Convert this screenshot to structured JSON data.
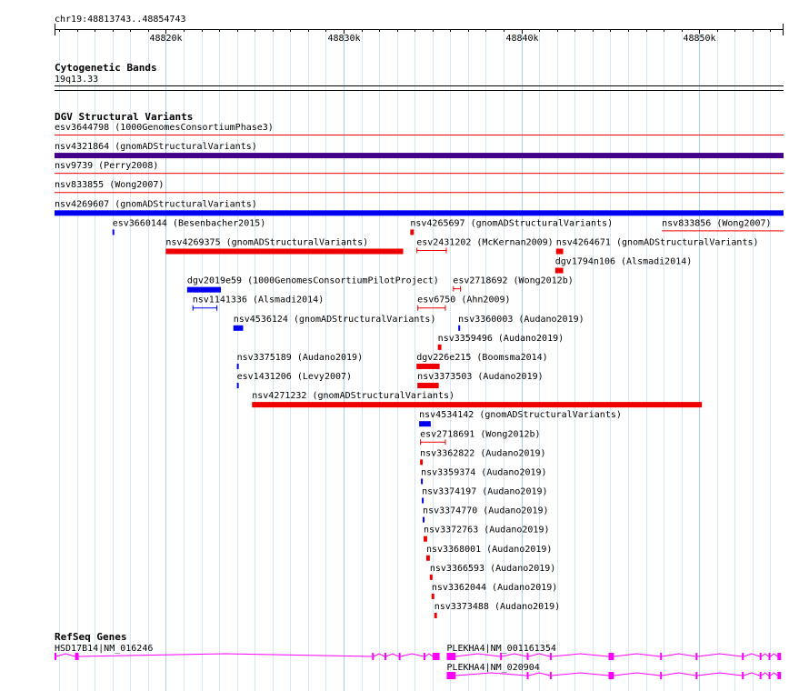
{
  "ruler": {
    "segment_label": "chr19:48813743..48854743",
    "start": 48813743,
    "end": 48854743,
    "ticks": [
      {
        "pos": 48820000,
        "label": "48820k"
      },
      {
        "pos": 48830000,
        "label": "48830k"
      },
      {
        "pos": 48840000,
        "label": "48840k"
      },
      {
        "pos": 48850000,
        "label": "48850k"
      }
    ]
  },
  "tracks": {
    "cytoband": {
      "title": "Cytogenetic Bands",
      "band_label": "19q13.33"
    },
    "dgv": {
      "title": "DGV Structural Variants",
      "colors": {
        "loss": "#ee0000",
        "gain": "#0000ee",
        "complex": "#440088"
      },
      "features": [
        {
          "name": "esv3644798 (1000GenomesConsortiumPhase3)",
          "start": 48813743,
          "end": 48854743,
          "type": "loss",
          "style": "line"
        },
        {
          "name": "nsv4321864 (gnomADStructuralVariants)",
          "start": 48813743,
          "end": 48854743,
          "type": "complex",
          "style": "bar"
        },
        {
          "name": "nsv9739 (Perry2008)",
          "start": 48813743,
          "end": 48854743,
          "type": "loss",
          "style": "line"
        },
        {
          "name": "nsv833855 (Wong2007)",
          "start": 48813743,
          "end": 48854743,
          "type": "loss",
          "style": "line"
        },
        {
          "name": "nsv4269607 (gnomADStructuralVariants)",
          "start": 48813743,
          "end": 48854743,
          "type": "gain",
          "style": "bar"
        },
        {
          "name": "esv3660144 (Besenbacher2015)",
          "start": 48817000,
          "end": 48817100,
          "type": "gain",
          "style": "bar"
        },
        {
          "name": "nsv4265697 (gnomADStructuralVariants)",
          "start": 48833750,
          "end": 48833950,
          "type": "loss",
          "style": "bar"
        },
        {
          "name": "nsv833856 (Wong2007)",
          "start": 48847900,
          "end": 48854743,
          "type": "loss",
          "style": "line"
        },
        {
          "name": "nsv4269375 (gnomADStructuralVariants)",
          "start": 48820000,
          "end": 48833350,
          "type": "loss",
          "style": "bar"
        },
        {
          "name": "esv2431202 (McKernan2009)",
          "start": 48834100,
          "end": 48835800,
          "type": "loss",
          "style": "interval"
        },
        {
          "name": "dgv1794n106 (Alsmadi2014)",
          "start": 48841900,
          "end": 48842350,
          "type": "loss",
          "style": "bar"
        },
        {
          "name": "dgv2019e59 (1000GenomesConsortiumPilotProject)",
          "start": 48821200,
          "end": 48823100,
          "type": "gain",
          "style": "bar"
        },
        {
          "name": "esv2718692 (Wong2012b)",
          "start": 48836150,
          "end": 48836600,
          "type": "loss",
          "style": "interval"
        },
        {
          "name": "nsv1141336 (Alsmadi2014)",
          "start": 48821500,
          "end": 48822900,
          "type": "gain",
          "style": "interval"
        },
        {
          "name": "esv6750 (Ahn2009)",
          "start": 48834150,
          "end": 48835750,
          "type": "loss",
          "style": "interval"
        },
        {
          "name": "nsv4264671 (gnomADStructuralVariants)",
          "start": 48841950,
          "end": 48842350,
          "type": "loss",
          "style": "bar"
        },
        {
          "name": "nsv4536124 (gnomADStructuralVariants)",
          "start": 48823800,
          "end": 48824350,
          "type": "gain",
          "style": "bar"
        },
        {
          "name": "nsv3359496 (Audano2019)",
          "start": 48835300,
          "end": 48835500,
          "type": "loss",
          "style": "bar"
        },
        {
          "name": "nsv3375189 (Audano2019)",
          "start": 48824000,
          "end": 48824100,
          "type": "gain",
          "style": "bar"
        },
        {
          "name": "dgv226e215 (Boomsma2014)",
          "start": 48834100,
          "end": 48835400,
          "type": "loss",
          "style": "bar"
        },
        {
          "name": "esv1431206 (Levy2007)",
          "start": 48824000,
          "end": 48824100,
          "type": "gain",
          "style": "bar"
        },
        {
          "name": "nsv3373503 (Audano2019)",
          "start": 48834150,
          "end": 48835350,
          "type": "loss",
          "style": "bar"
        },
        {
          "name": "nsv4271232 (gnomADStructuralVariants)",
          "start": 48824850,
          "end": 48850150,
          "type": "loss",
          "style": "bar"
        },
        {
          "name": "nsv4534142 (gnomADStructuralVariants)",
          "start": 48834250,
          "end": 48834900,
          "type": "gain",
          "style": "bar"
        },
        {
          "name": "esv2718691 (Wong2012b)",
          "start": 48834300,
          "end": 48835750,
          "type": "loss",
          "style": "interval"
        },
        {
          "name": "nsv3362822 (Audano2019)",
          "start": 48834300,
          "end": 48834450,
          "type": "loss",
          "style": "bar"
        },
        {
          "name": "nsv3359374 (Audano2019)",
          "start": 48834350,
          "end": 48834450,
          "type": "gain",
          "style": "bar"
        },
        {
          "name": "nsv3374197 (Audano2019)",
          "start": 48834400,
          "end": 48834500,
          "type": "gain",
          "style": "bar"
        },
        {
          "name": "nsv3374770 (Audano2019)",
          "start": 48834450,
          "end": 48834550,
          "type": "gain",
          "style": "bar"
        },
        {
          "name": "nsv3372763 (Audano2019)",
          "start": 48834500,
          "end": 48834700,
          "type": "loss",
          "style": "bar"
        },
        {
          "name": "nsv3368001 (Audano2019)",
          "start": 48834650,
          "end": 48834850,
          "type": "loss",
          "style": "bar"
        },
        {
          "name": "nsv3366593 (Audano2019)",
          "start": 48834850,
          "end": 48835000,
          "type": "loss",
          "style": "bar"
        },
        {
          "name": "nsv3362044 (Audano2019)",
          "start": 48834950,
          "end": 48835100,
          "type": "loss",
          "style": "bar"
        },
        {
          "name": "nsv3373488 (Audano2019)",
          "start": 48835100,
          "end": 48835250,
          "type": "loss",
          "style": "bar"
        },
        {
          "name": "nsv3360003 (Audano2019)",
          "start": 48836450,
          "end": 48836550,
          "type": "gain",
          "style": "bar"
        }
      ]
    },
    "refseq": {
      "title": "RefSeq Genes",
      "color": "#ff00ff",
      "genes": [
        {
          "name": "HSD17B14|NM_016246",
          "start": 48813743,
          "end": 48835400,
          "exons": [
            [
              48813743,
              48813800
            ],
            [
              48814900,
              48815100
            ],
            [
              48831600,
              48831700
            ],
            [
              48832300,
              48832400
            ],
            [
              48833100,
              48833200
            ],
            [
              48834500,
              48834600
            ],
            [
              48835000,
              48835400
            ]
          ]
        },
        {
          "name": "PLEKHA4|NM_001161354",
          "start": 48835800,
          "end": 48854743,
          "exons": [
            [
              48835800,
              48836300
            ],
            [
              48838800,
              48838900
            ],
            [
              48840300,
              48840400
            ],
            [
              48841600,
              48841700
            ],
            [
              48844900,
              48845200
            ],
            [
              48847800,
              48847900
            ],
            [
              48849800,
              48849900
            ],
            [
              48852400,
              48852500
            ],
            [
              48853400,
              48853500
            ],
            [
              48853900,
              48854000
            ],
            [
              48854400,
              48854600
            ]
          ]
        },
        {
          "name": "PLEKHA4|NM_020904",
          "start": 48835800,
          "end": 48854743,
          "exons": [
            [
              48835800,
              48836300
            ],
            [
              48840300,
              48840400
            ],
            [
              48841600,
              48841700
            ],
            [
              48844900,
              48845200
            ],
            [
              48847800,
              48847900
            ],
            [
              48849800,
              48849900
            ],
            [
              48852400,
              48852500
            ],
            [
              48853400,
              48853500
            ],
            [
              48853900,
              48854000
            ],
            [
              48854400,
              48854600
            ]
          ]
        }
      ]
    }
  }
}
